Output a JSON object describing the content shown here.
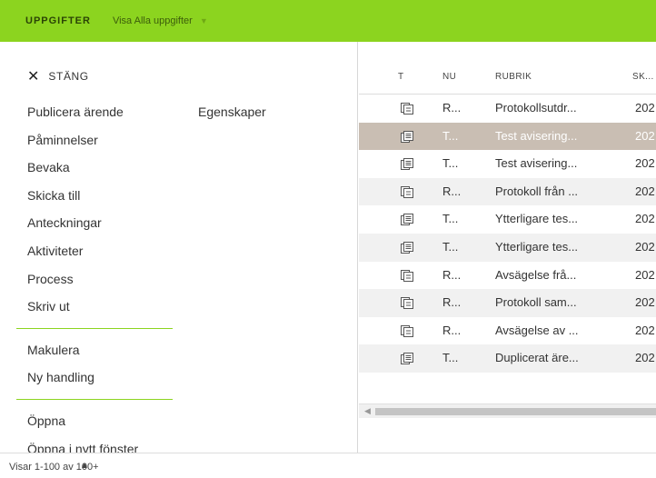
{
  "colors": {
    "accent": "#8cd41f",
    "selected_row": "#c9beb3",
    "alt_row": "#f1f1f1"
  },
  "topbar": {
    "title": "UPPGIFTER",
    "filter_label": "Visa Alla uppgifter",
    "filter_icon": "caret-down-icon"
  },
  "panel": {
    "close_label": "STÄNG",
    "close_icon": "close-icon",
    "group1": [
      "Publicera ärende",
      "Påminnelser",
      "Bevaka",
      "Skicka till",
      "Anteckningar",
      "Aktiviteter",
      "Process",
      "Skriv ut"
    ],
    "group2": [
      "Makulera",
      "Ny handling"
    ],
    "group3": [
      "Öppna",
      "Öppna i nytt fönster"
    ],
    "secondary": "Egenskaper"
  },
  "table": {
    "columns": [
      "T",
      "NU",
      "RUBRIK",
      "SK..."
    ],
    "rows": [
      {
        "icon": "document-stack-icon",
        "nr": "R...",
        "rubrik": "Protokollsutdr...",
        "sk": "202"
      },
      {
        "icon": "document-list-icon",
        "nr": "T...",
        "rubrik": "Test avisering...",
        "sk": "202",
        "selected": true
      },
      {
        "icon": "document-list-icon",
        "nr": "T...",
        "rubrik": "Test avisering...",
        "sk": "202"
      },
      {
        "icon": "document-stack-icon",
        "nr": "R...",
        "rubrik": "Protokoll från ...",
        "sk": "202"
      },
      {
        "icon": "document-list-icon",
        "nr": "T...",
        "rubrik": "Ytterligare tes...",
        "sk": "202"
      },
      {
        "icon": "document-list-icon",
        "nr": "T...",
        "rubrik": "Ytterligare tes...",
        "sk": "202"
      },
      {
        "icon": "document-stack-icon",
        "nr": "R...",
        "rubrik": "Avsägelse frå...",
        "sk": "202"
      },
      {
        "icon": "document-stack-icon",
        "nr": "R...",
        "rubrik": "Protokoll sam...",
        "sk": "202"
      },
      {
        "icon": "document-stack-icon",
        "nr": "R...",
        "rubrik": "Avsägelse av ...",
        "sk": "202"
      },
      {
        "icon": "document-list-icon",
        "nr": "T...",
        "rubrik": "Duplicerat äre...",
        "sk": "202"
      }
    ]
  },
  "footer": {
    "status": "Visar 1-100 av 100+",
    "toggle_icon": "chevron-up-icon"
  }
}
